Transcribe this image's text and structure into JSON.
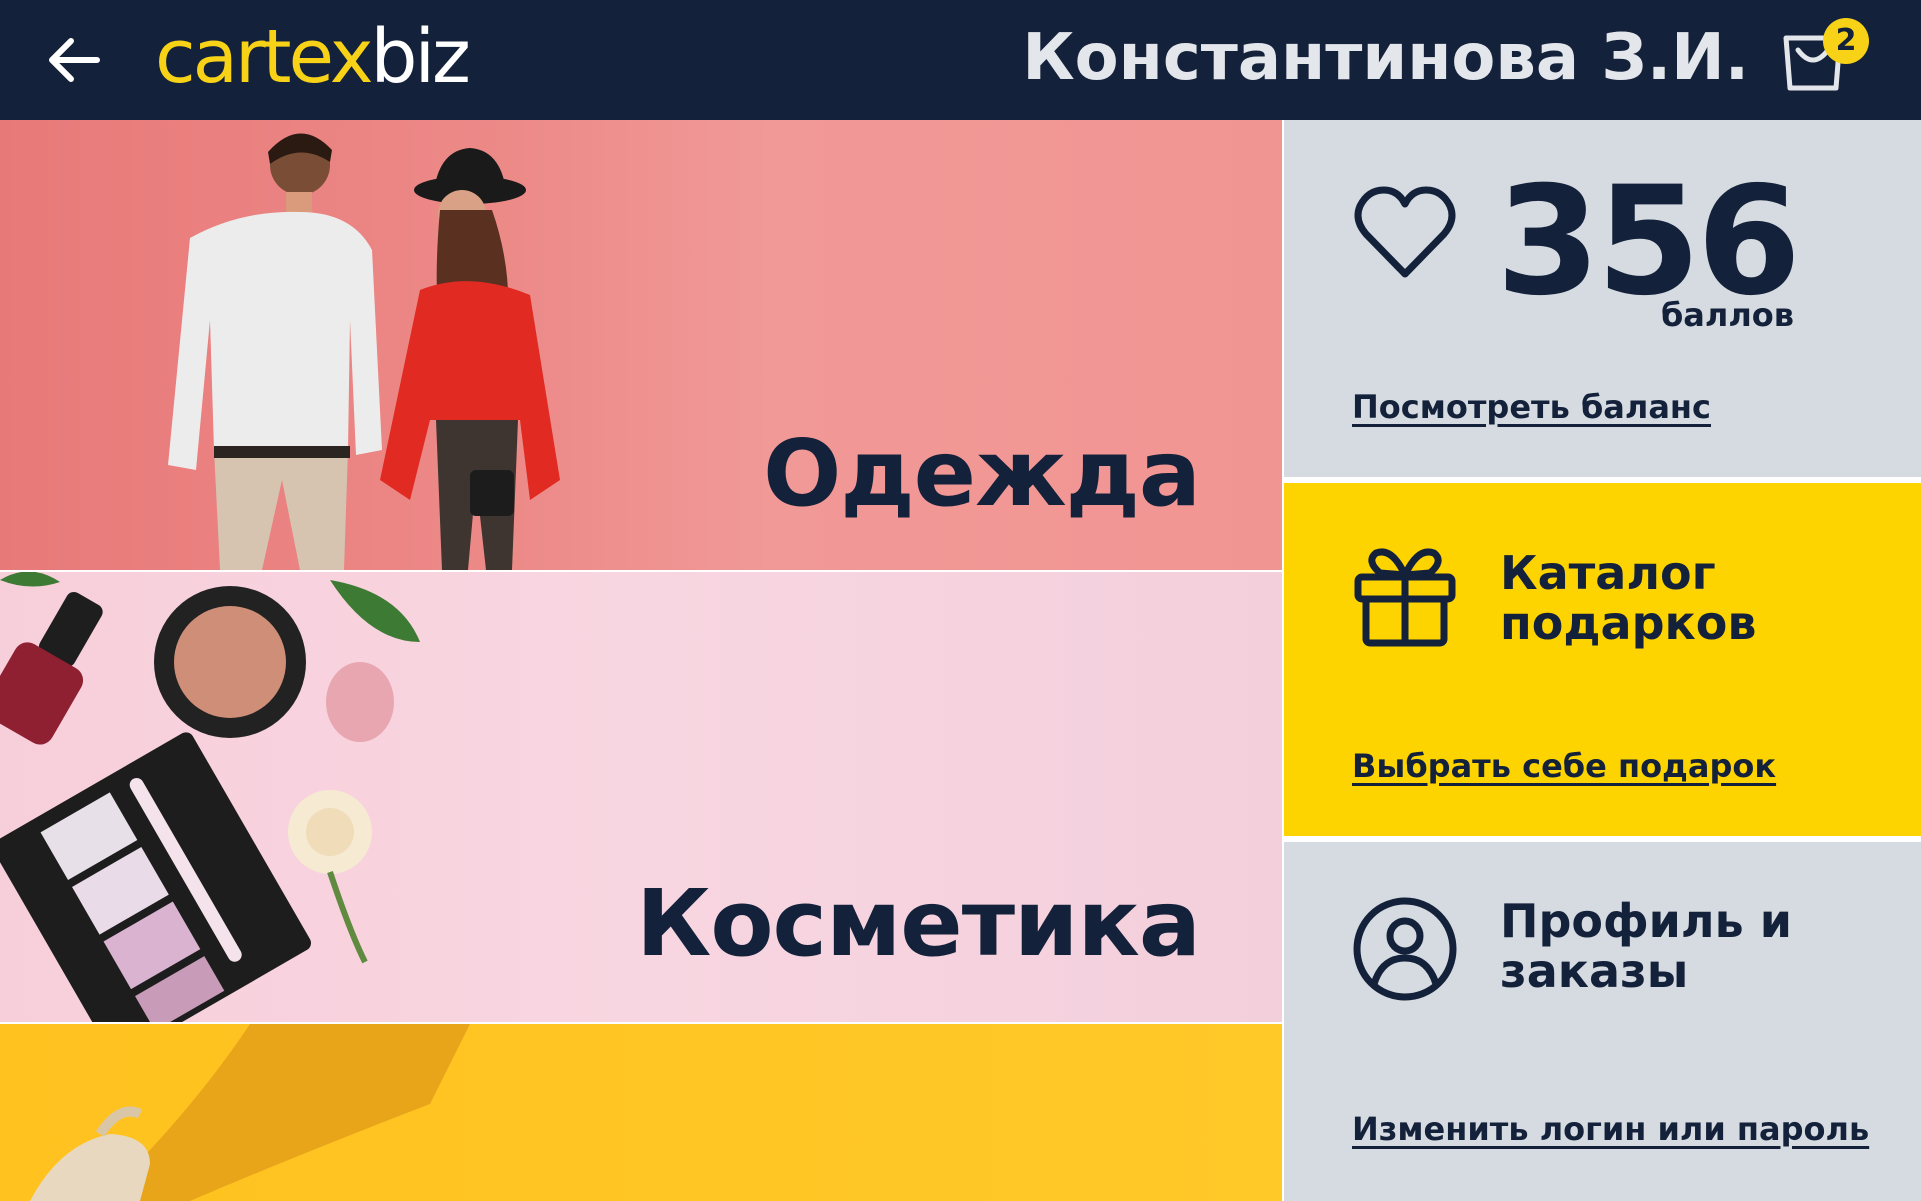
{
  "header": {
    "back_icon": "arrow-left-icon",
    "logo_part1": "cartex",
    "logo_part2": "biz",
    "user_name": "Константинова З.И.",
    "cart_icon": "shopping-bag-icon",
    "cart_count": "2"
  },
  "categories": [
    {
      "label": "Одежда",
      "color": "#f19997"
    },
    {
      "label": "Косметика",
      "color": "#f8d6e1"
    },
    {
      "label": "",
      "color": "#ffc928"
    }
  ],
  "points_card": {
    "icon": "heart-icon",
    "value": "356",
    "unit": "баллов",
    "link": "Посмотреть баланс"
  },
  "gifts_card": {
    "icon": "gift-icon",
    "title_line1": "Каталог",
    "title_line2": "подарков",
    "link": "Выбрать себе подарок"
  },
  "profile_card": {
    "icon": "user-circle-icon",
    "title_line1": "Профиль и",
    "title_line2": "заказы",
    "link": "Изменить логин или пароль"
  },
  "colors": {
    "header_bg": "#14213a",
    "accent_yellow": "#fed400",
    "card_gray": "#d5dbe0",
    "text_dark": "#14213a"
  }
}
